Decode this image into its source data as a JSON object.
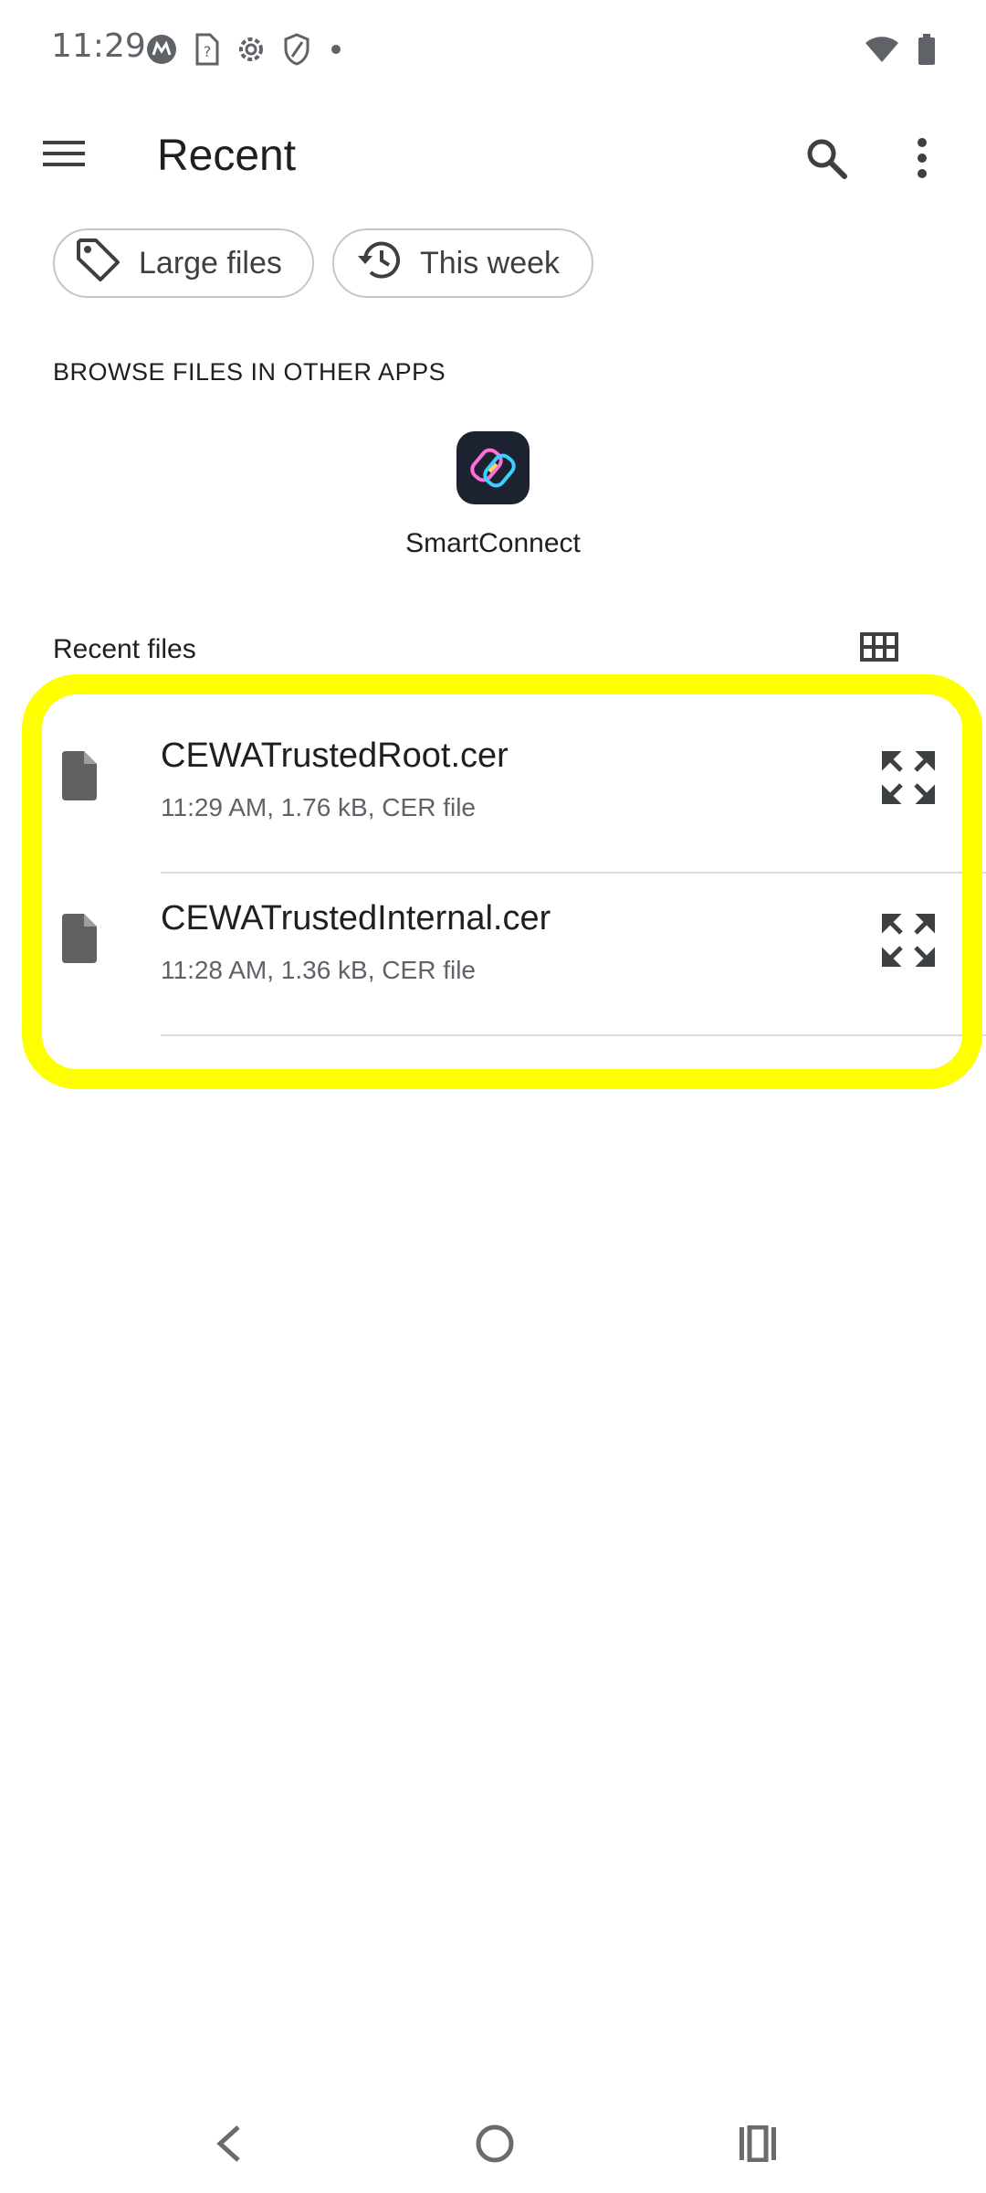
{
  "status_bar": {
    "time": "11:29",
    "left_icons": [
      "motorola-icon",
      "sim-unknown-icon",
      "settings-icon",
      "shield-icon",
      "dot-icon"
    ],
    "right_icons": [
      "wifi-icon",
      "battery-icon"
    ]
  },
  "app_bar": {
    "title": "Recent",
    "icons": [
      "menu-icon",
      "search-icon",
      "more-vert-icon"
    ]
  },
  "chips": [
    {
      "label": "Large files",
      "icon": "tag-icon"
    },
    {
      "label": "This week",
      "icon": "history-icon"
    }
  ],
  "browse": {
    "heading": "BROWSE FILES IN OTHER APPS",
    "apps": [
      {
        "label": "SmartConnect",
        "icon": "smartconnect-icon"
      }
    ]
  },
  "recent_files": {
    "heading": "Recent files",
    "view_icon": "grid-view-icon",
    "items": [
      {
        "name": "CEWATrustedRoot.cer",
        "meta": "11:29 AM, 1.76 kB, CER file",
        "icon": "file-icon",
        "action_icon": "expand-icon"
      },
      {
        "name": "CEWATrustedInternal.cer",
        "meta": "11:28 AM, 1.36 kB, CER file",
        "icon": "file-icon",
        "action_icon": "expand-icon"
      }
    ]
  },
  "highlight_color": "#ffff00",
  "nav_bar": {
    "icons": [
      "back-icon",
      "home-icon",
      "recents-icon"
    ]
  }
}
